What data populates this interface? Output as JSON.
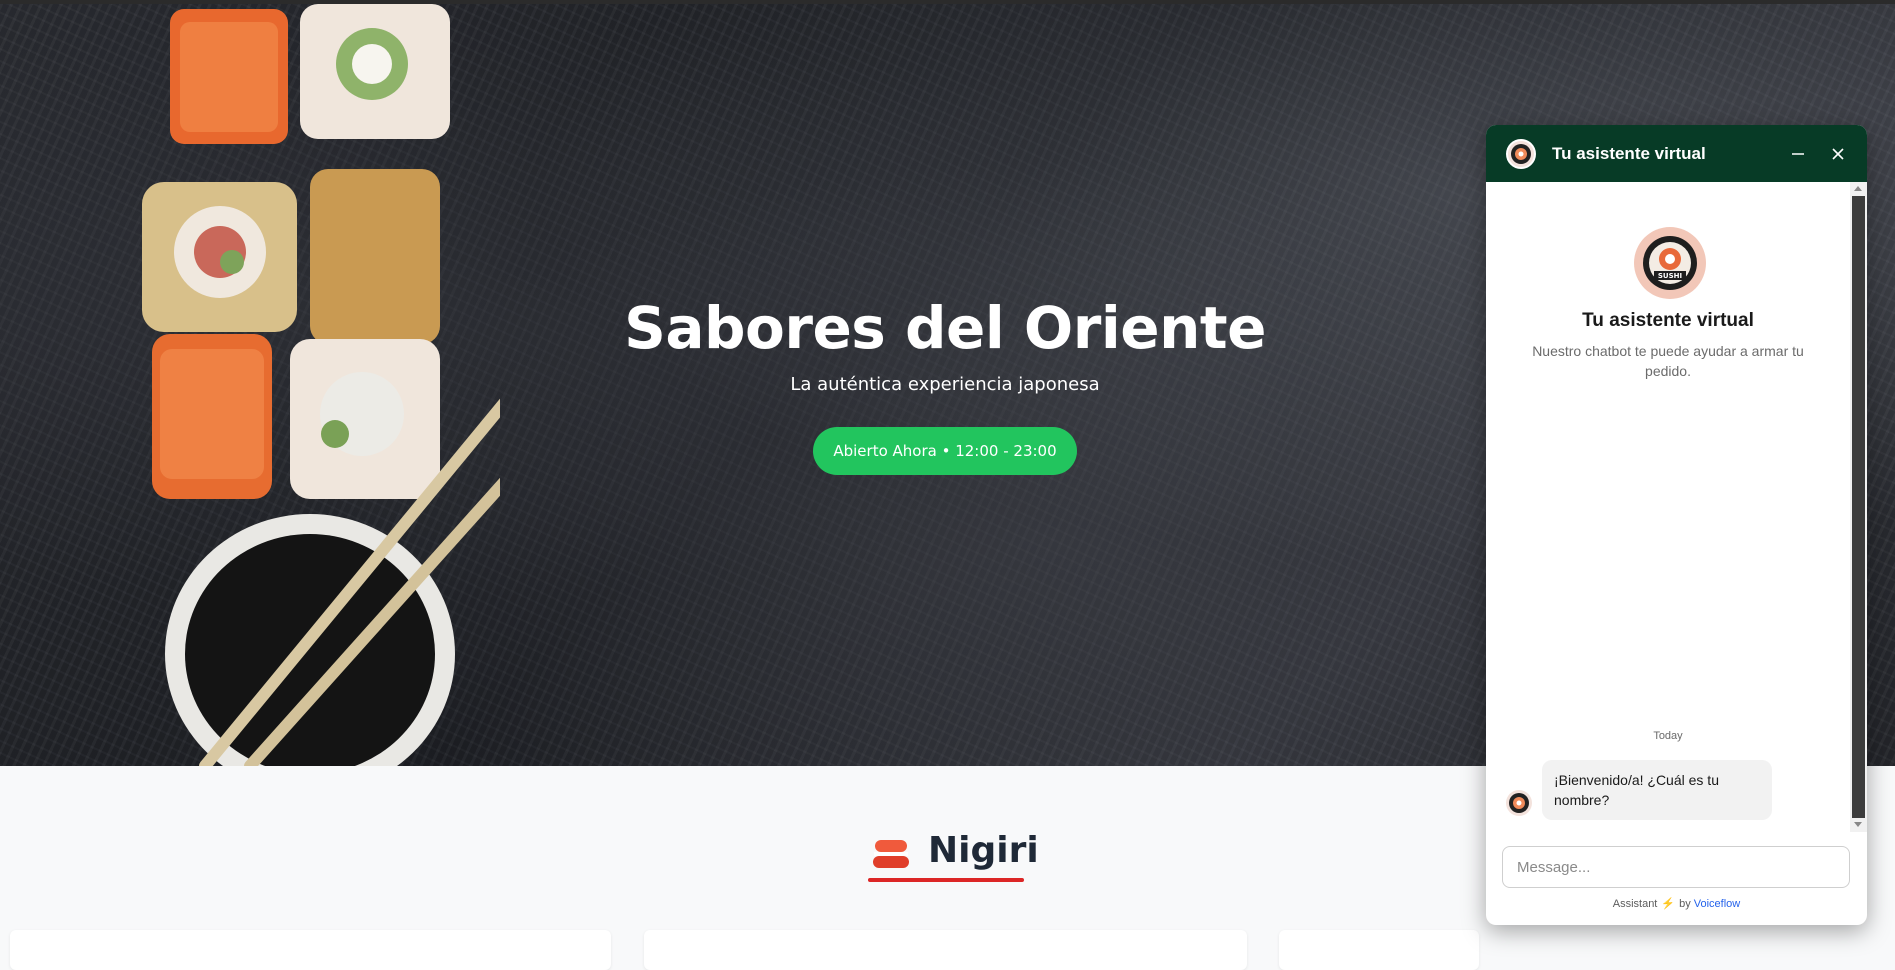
{
  "hero": {
    "title": "Sabores del Oriente",
    "subtitle": "La auténtica experiencia japonesa",
    "status_badge": "Abierto Ahora • 12:00 - 23:00"
  },
  "menu_section": {
    "title": "Nigiri",
    "icon": "nigiri-icon"
  },
  "chat": {
    "header_title": "Tu asistente virtual",
    "bot_name": "Tu asistente virtual",
    "bot_description": "Nuestro chatbot te puede ayudar a armar tu pedido.",
    "date_separator": "Today",
    "messages": [
      {
        "from": "bot",
        "text": "¡Bienvenido/a! ¿Cuál es tu nombre?"
      }
    ],
    "composer_placeholder": "Message...",
    "footer_prefix": "Assistant",
    "footer_by": "by",
    "footer_brand": "Voiceflow",
    "logo_text": "SUSHI"
  },
  "colors": {
    "header_green": "#073b26",
    "badge_green": "#22c55e",
    "accent_red": "#dc2626",
    "brand_link": "#2563eb"
  }
}
